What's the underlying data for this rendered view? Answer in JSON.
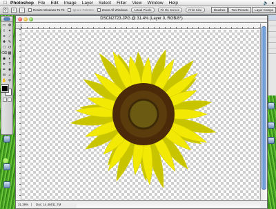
{
  "menubar": {
    "app_name": "Photoshop",
    "items": [
      "File",
      "Edit",
      "Image",
      "Layer",
      "Select",
      "Filter",
      "View",
      "Window",
      "Help"
    ]
  },
  "options_bar": {
    "resize_windows_label": "Resize Windows To Fit",
    "ignore_palettes_label": "Ignore Palettes",
    "zoom_all_windows_label": "Zoom All Windows",
    "actual_pixels_label": "Actual Pixels",
    "fit_on_screen_label": "Fit On Screen",
    "print_size_label": "Print Size"
  },
  "palette_well": {
    "tabs": [
      "Brushes",
      "Tool Presets",
      "Layer Comps"
    ]
  },
  "document": {
    "title": "DSCN2723.JPG @ 31.4% (Layer 0, RGB/8*)",
    "zoom": "31.39%",
    "doc_info": "Doc: 14.4M/11.7M"
  },
  "colors": {
    "petal": "#f2ea05",
    "petal_dark": "#c9c400",
    "center_outer": "#4a2a08",
    "center_inner": "#6b5a12",
    "foreground": "#000000",
    "background": "#ffffff",
    "accent_scroll": "#5d8fd2"
  },
  "tools": [
    "marquee-icon",
    "move-icon",
    "lasso-icon",
    "magic-wand-icon",
    "crop-icon",
    "slice-icon",
    "healing-brush-icon",
    "brush-icon",
    "clone-stamp-icon",
    "history-brush-icon",
    "eraser-icon",
    "gradient-icon",
    "blur-icon",
    "dodge-icon",
    "path-select-icon",
    "type-icon",
    "pen-icon",
    "shape-icon",
    "notes-icon",
    "eyedropper-icon",
    "hand-icon",
    "zoom-icon"
  ]
}
